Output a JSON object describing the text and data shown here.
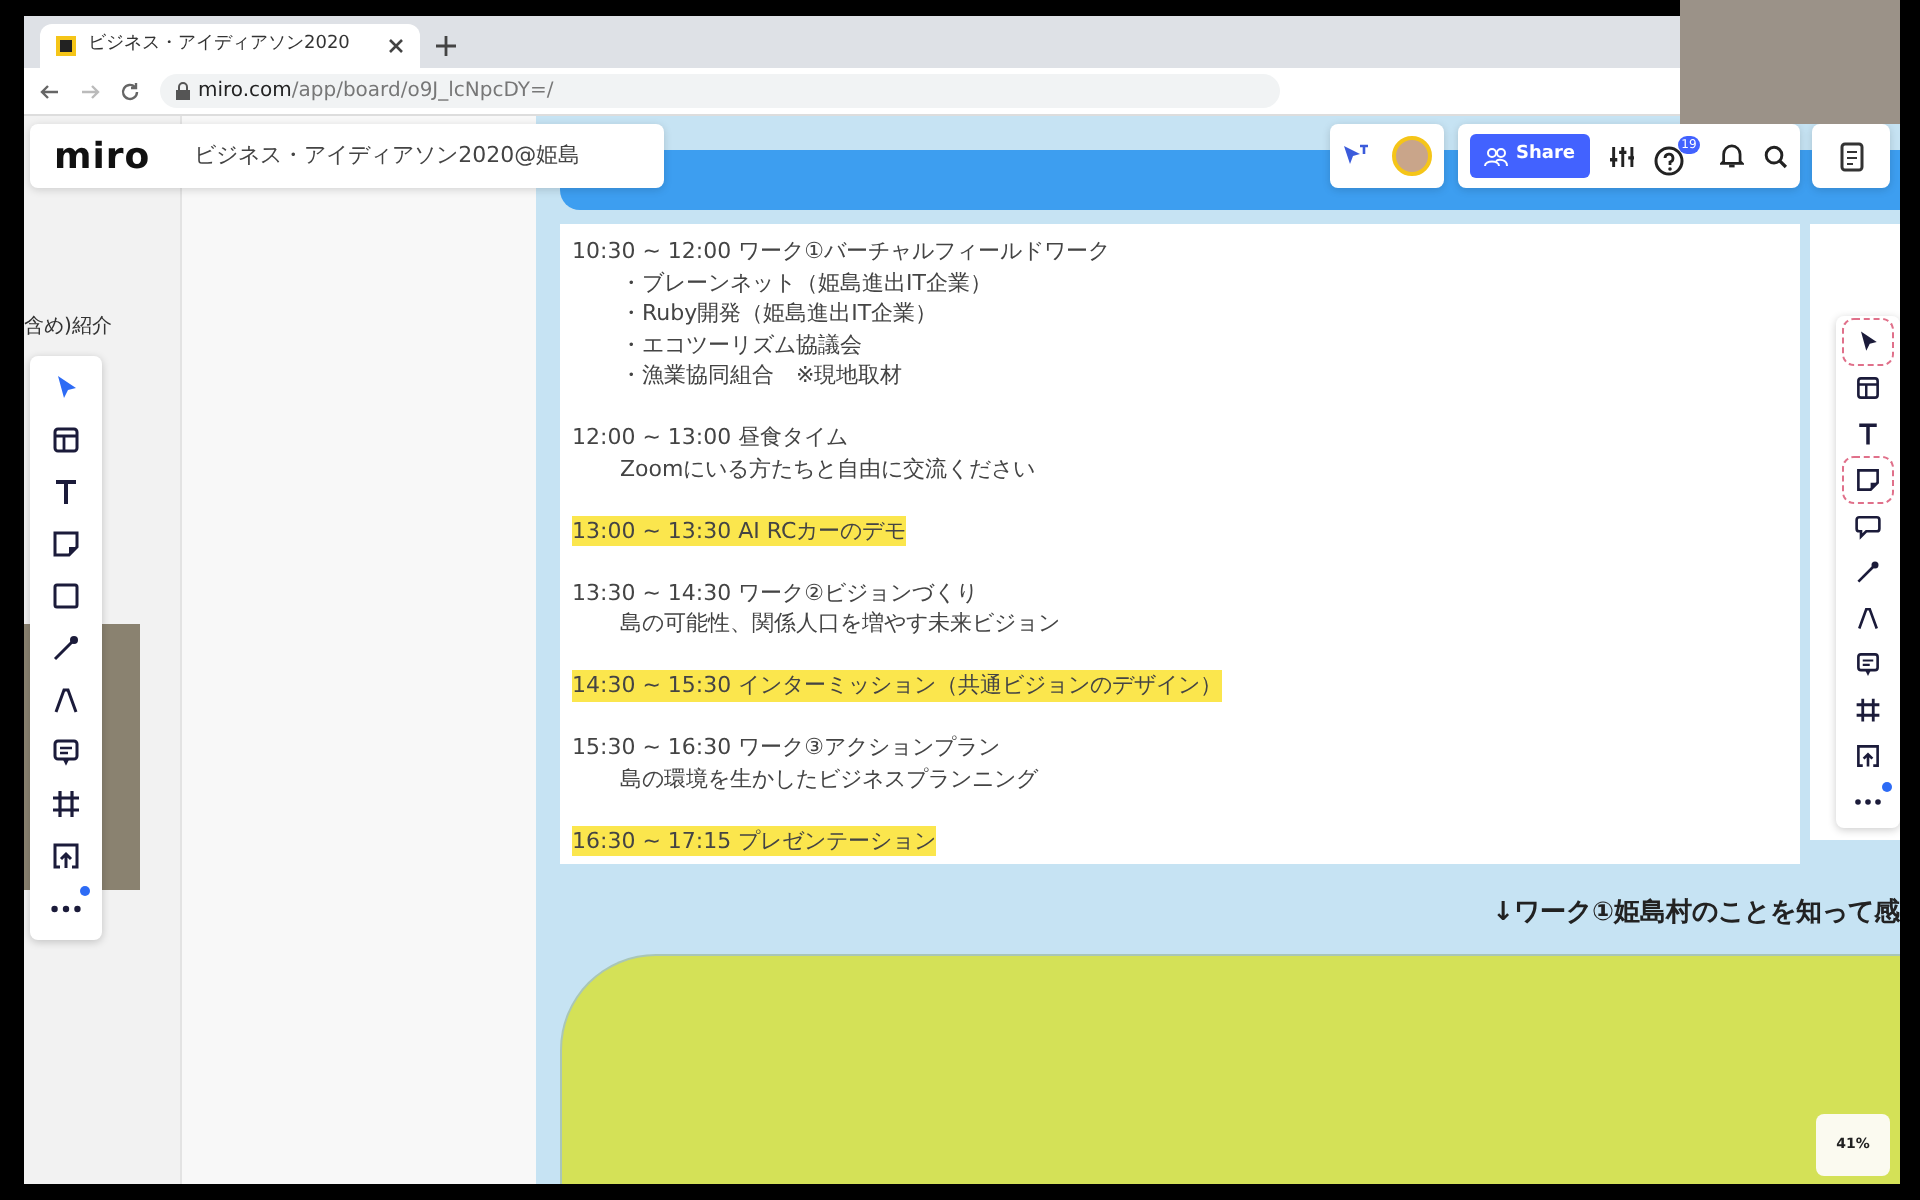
{
  "browser": {
    "tab": {
      "title": "ビジネス・アイディアソン2020"
    },
    "url_host": "miro.com",
    "url_path": "/app/board/o9J_lcNpcDY=/"
  },
  "board_header": {
    "logo": "miro",
    "title": "ビジネス・アイディアソン2020@姫島"
  },
  "top_right": {
    "share_label": "Share",
    "help_badge": "19"
  },
  "side_note": "含め)紹介",
  "left_toolbar": [
    {
      "kind": "select",
      "selected": true,
      "notified": false
    },
    {
      "kind": "template",
      "selected": false,
      "notified": false
    },
    {
      "kind": "text",
      "selected": false,
      "notified": false
    },
    {
      "kind": "sticky",
      "selected": false,
      "notified": false
    },
    {
      "kind": "shape",
      "selected": false,
      "notified": false
    },
    {
      "kind": "line",
      "selected": false,
      "notified": false
    },
    {
      "kind": "pen",
      "selected": false,
      "notified": false
    },
    {
      "kind": "comment",
      "selected": false,
      "notified": false
    },
    {
      "kind": "frame",
      "selected": false,
      "notified": false
    },
    {
      "kind": "upload",
      "selected": false,
      "notified": false
    },
    {
      "kind": "more",
      "selected": false,
      "notified": true
    }
  ],
  "right_toolbar": [
    {
      "kind": "select",
      "highlighted": true,
      "notified": false
    },
    {
      "kind": "template",
      "highlighted": false,
      "notified": false
    },
    {
      "kind": "text",
      "highlighted": false,
      "notified": false
    },
    {
      "kind": "sticky",
      "highlighted": true,
      "notified": false
    },
    {
      "kind": "chat",
      "highlighted": false,
      "notified": false
    },
    {
      "kind": "line",
      "highlighted": false,
      "notified": false
    },
    {
      "kind": "pen",
      "highlighted": false,
      "notified": false
    },
    {
      "kind": "comment",
      "highlighted": false,
      "notified": false
    },
    {
      "kind": "frame",
      "highlighted": false,
      "notified": false
    },
    {
      "kind": "upload",
      "highlighted": false,
      "notified": false
    },
    {
      "kind": "more",
      "highlighted": false,
      "notified": true
    }
  ],
  "schedule": [
    {
      "text": "10:30 ~ 12:00  ワーク①バーチャルフィールドワーク",
      "highlighted": false,
      "children": [
        {
          "text": "・ブレーンネット（姫島進出IT企業）"
        },
        {
          "text": "・Ruby開発（姫島進出IT企業）"
        },
        {
          "text": "・エコツーリズム協議会"
        },
        {
          "text": "・漁業協同組合　※現地取材"
        }
      ]
    },
    {
      "text": "12:00 ~ 13:00  昼食タイム",
      "highlighted": false,
      "children": [
        {
          "text": "Zoomにいる方たちと自由に交流ください"
        }
      ]
    },
    {
      "text": "13:00 ~ 13:30  AI RCカーのデモ",
      "highlighted": true
    },
    {
      "text": "13:30 ~ 14:30 ワーク②ビジョンづくり",
      "highlighted": false,
      "children": [
        {
          "text": "島の可能性、関係人口を増やす未来ビジョン"
        }
      ]
    },
    {
      "text": "14:30 ~ 15:30 インターミッション（共通ビジョンのデザイン）",
      "highlighted": true
    },
    {
      "text": "15:30 ~ 16:30 ワーク③アクションプラン",
      "highlighted": false,
      "children": [
        {
          "text": "島の環境を生かしたビジネスプランニング"
        }
      ]
    },
    {
      "text": "16:30 ~ 17:15 プレゼンテーション",
      "highlighted": true
    }
  ],
  "section_heading": "↓ワーク①姫島村のことを知って感",
  "zoom_level": "41%"
}
